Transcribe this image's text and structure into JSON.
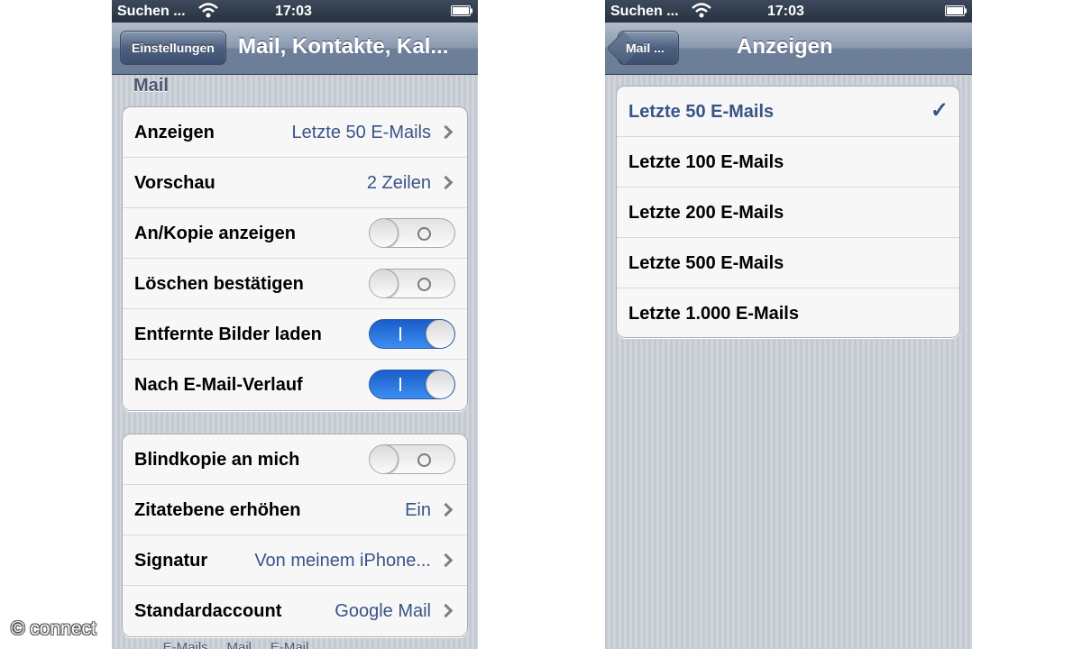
{
  "watermark": "© connect",
  "left": {
    "status": {
      "carrier": "Suchen ...",
      "time": "17:03"
    },
    "nav": {
      "back_label": "Einstellungen",
      "title": "Mail, Kontakte, Kal..."
    },
    "section_header": "Mail",
    "group1": [
      {
        "label": "Anzeigen",
        "value": "Letzte 50 E-Mails"
      },
      {
        "label": "Vorschau",
        "value": "2 Zeilen"
      },
      {
        "label": "An/Kopie anzeigen",
        "toggle": "off"
      },
      {
        "label": "Löschen bestätigen",
        "toggle": "off"
      },
      {
        "label": "Entfernte Bilder laden",
        "toggle": "on"
      },
      {
        "label": "Nach E-Mail-Verlauf",
        "toggle": "on"
      }
    ],
    "group2": [
      {
        "label": "Blindkopie an mich",
        "toggle": "off"
      },
      {
        "label": "Zitatebene erhöhen",
        "value": "Ein"
      },
      {
        "label": "Signatur",
        "value": "Von meinem iPhone..."
      },
      {
        "label": "Standardaccount",
        "value": "Google Mail"
      }
    ],
    "partial_footer": "... E-Mails ... Mail ... E-Mail ..."
  },
  "right": {
    "status": {
      "carrier": "Suchen ...",
      "time": "17:03"
    },
    "nav": {
      "back_label": "Mail ...",
      "title": "Anzeigen"
    },
    "options": [
      {
        "label": "Letzte 50 E-Mails",
        "selected": true
      },
      {
        "label": "Letzte 100 E-Mails",
        "selected": false
      },
      {
        "label": "Letzte 200 E-Mails",
        "selected": false
      },
      {
        "label": "Letzte 500 E-Mails",
        "selected": false
      },
      {
        "label": "Letzte 1.000 E-Mails",
        "selected": false
      }
    ]
  },
  "colors": {
    "navbar": "#7f8fa6",
    "statusbar": "#2f3a48",
    "value_text": "#385487",
    "toggle_on": "#2a78e4",
    "background": "#c9ced6"
  },
  "icons": [
    "wifi-icon",
    "battery-icon",
    "chevron-right-icon",
    "checkmark-icon",
    "back-arrow-icon"
  ]
}
